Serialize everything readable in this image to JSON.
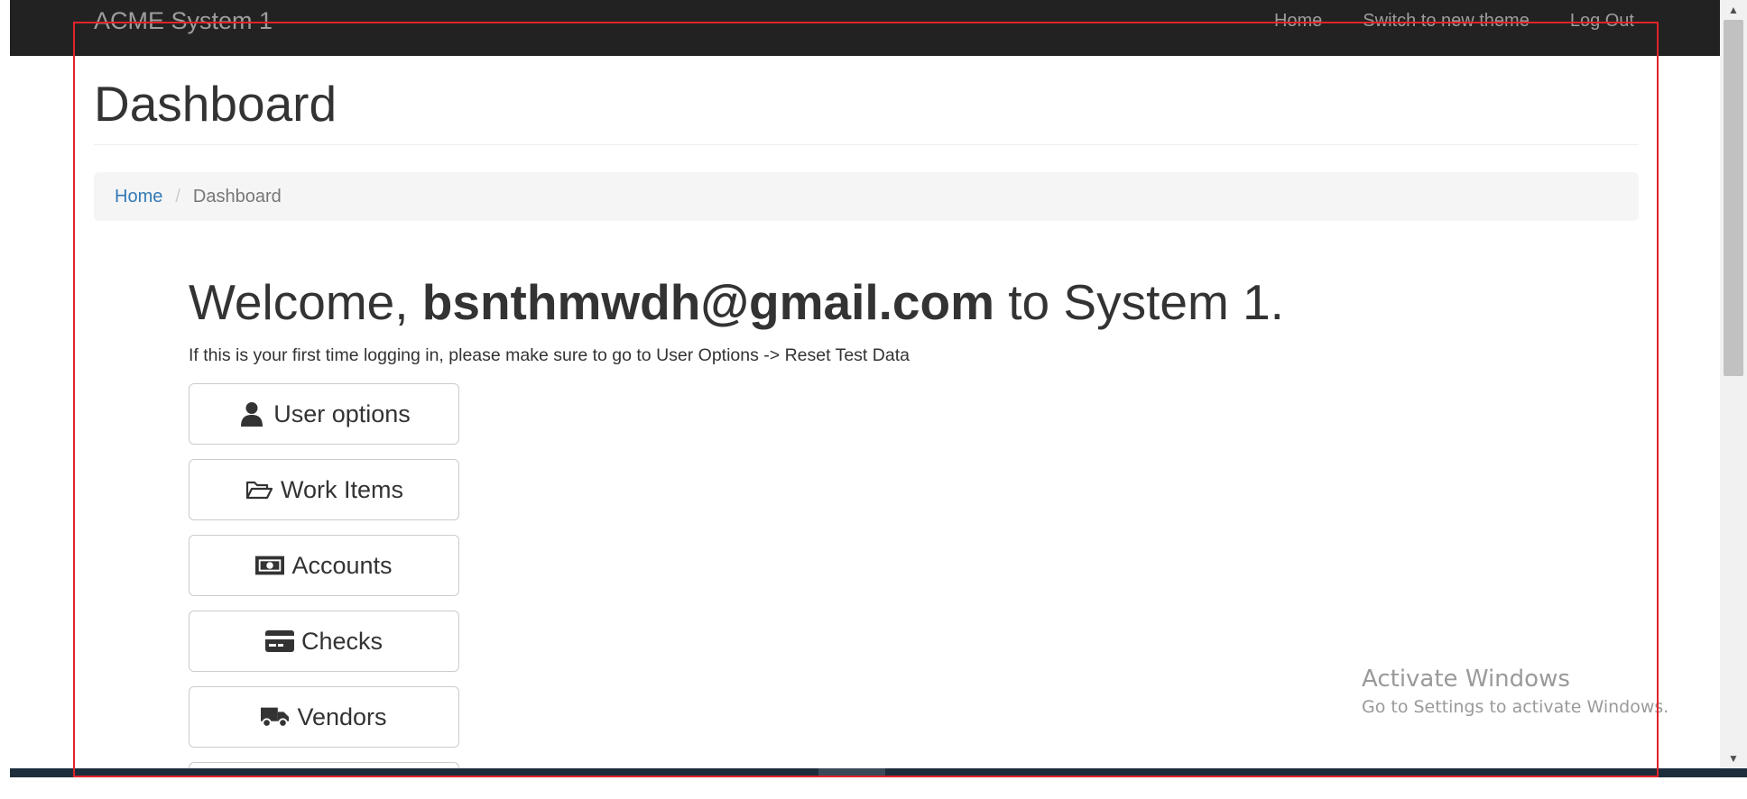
{
  "navbar": {
    "brand": "ACME System 1",
    "links": [
      "Home",
      "Switch to new theme",
      "Log Out"
    ]
  },
  "page": {
    "title": "Dashboard"
  },
  "breadcrumb": {
    "home": "Home",
    "separator": "/",
    "current": "Dashboard"
  },
  "welcome": {
    "prefix": "Welcome,",
    "user": "bsnthmwdh@gmail.com",
    "suffix": "to System 1.",
    "note": "If this is your first time logging in, please make sure to go to User Options -> Reset Test Data"
  },
  "buttons": [
    {
      "label": "User options",
      "icon": "user-icon"
    },
    {
      "label": "Work Items",
      "icon": "folder-open-icon"
    },
    {
      "label": "Accounts",
      "icon": "money-bill-icon"
    },
    {
      "label": "Checks",
      "icon": "credit-card-icon"
    },
    {
      "label": "Vendors",
      "icon": "truck-icon"
    }
  ],
  "watermark": {
    "title": "Activate Windows",
    "subtitle": "Go to Settings to activate Windows."
  },
  "colors": {
    "navbar_bg": "#222222",
    "link": "#337ab7",
    "highlight": "#e0242a"
  }
}
